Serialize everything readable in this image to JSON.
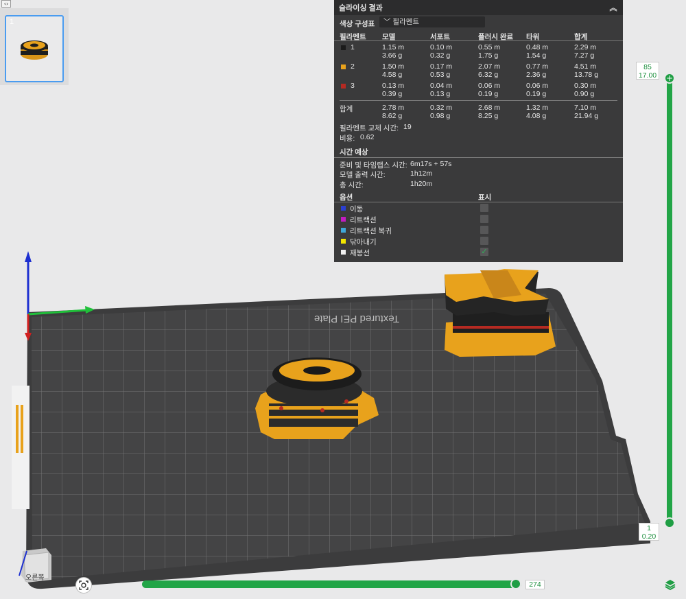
{
  "thumbnail": {
    "plate_index": "1"
  },
  "results": {
    "title": "슬라이싱 결과",
    "color_scheme_label": "색상 구성표",
    "color_scheme_value": "필라멘트",
    "columns": [
      "필라멘트",
      "모델",
      "서포트",
      "플러시 완료",
      "타워",
      "합계"
    ],
    "filaments": [
      {
        "id": "1",
        "color": "#1b1b1b",
        "model": [
          "1.15 m",
          "3.66 g"
        ],
        "support": [
          "0.10 m",
          "0.32 g"
        ],
        "flush": [
          "0.55 m",
          "1.75 g"
        ],
        "tower": [
          "0.48 m",
          "1.54 g"
        ],
        "total": [
          "2.29 m",
          "7.27 g"
        ]
      },
      {
        "id": "2",
        "color": "#e8a21c",
        "model": [
          "1.50 m",
          "4.58 g"
        ],
        "support": [
          "0.17 m",
          "0.53 g"
        ],
        "flush": [
          "2.07 m",
          "6.32 g"
        ],
        "tower": [
          "0.77 m",
          "2.36 g"
        ],
        "total": [
          "4.51 m",
          "13.78 g"
        ]
      },
      {
        "id": "3",
        "color": "#b52a22",
        "model": [
          "0.13 m",
          "0.39 g"
        ],
        "support": [
          "0.04 m",
          "0.13 g"
        ],
        "flush": [
          "0.06 m",
          "0.19 g"
        ],
        "tower": [
          "0.06 m",
          "0.19 g"
        ],
        "total": [
          "0.30 m",
          "0.90 g"
        ]
      }
    ],
    "sum": {
      "label": "합계",
      "model": [
        "2.78 m",
        "8.62 g"
      ],
      "support": [
        "0.32 m",
        "0.98 g"
      ],
      "flush": [
        "2.68 m",
        "8.25 g"
      ],
      "tower": [
        "1.32 m",
        "4.08 g"
      ],
      "total": [
        "7.10 m",
        "21.94 g"
      ]
    },
    "filament_change_label": "필라멘트 교체 시간:",
    "filament_change_value": "19",
    "cost_label": "비용:",
    "cost_value": "0.62",
    "time_section": "시간 예상",
    "prep_label": "준비 및 타임랩스 시간:",
    "prep_value": "6m17s + 57s",
    "model_time_label": "모델 출력 시간:",
    "model_time_value": "1h12m",
    "total_time_label": "총 시간:",
    "total_time_value": "1h20m",
    "options_label": "옵션",
    "display_label": "표시",
    "options": [
      {
        "label": "이동",
        "color": "#2b3fd1",
        "checked": false
      },
      {
        "label": "리트랙션",
        "color": "#c21cc2",
        "checked": false
      },
      {
        "label": "리트랙션 복귀",
        "color": "#3fa7d8",
        "checked": false
      },
      {
        "label": "닦아내기",
        "color": "#f2e600",
        "checked": false
      },
      {
        "label": "재봉선",
        "color": "#f0f0f0",
        "checked": true
      }
    ]
  },
  "plate_text": "Textured PEI Plate",
  "view_cube_label": "오른쪽",
  "vertical_slider": {
    "top_layer": "85",
    "top_height": "17.00",
    "bottom_layer": "1",
    "bottom_height": "0.20"
  },
  "horizontal_slider": {
    "value": "274"
  },
  "colors": {
    "accent_green": "#22a547",
    "filament_orange": "#e8a21c"
  }
}
